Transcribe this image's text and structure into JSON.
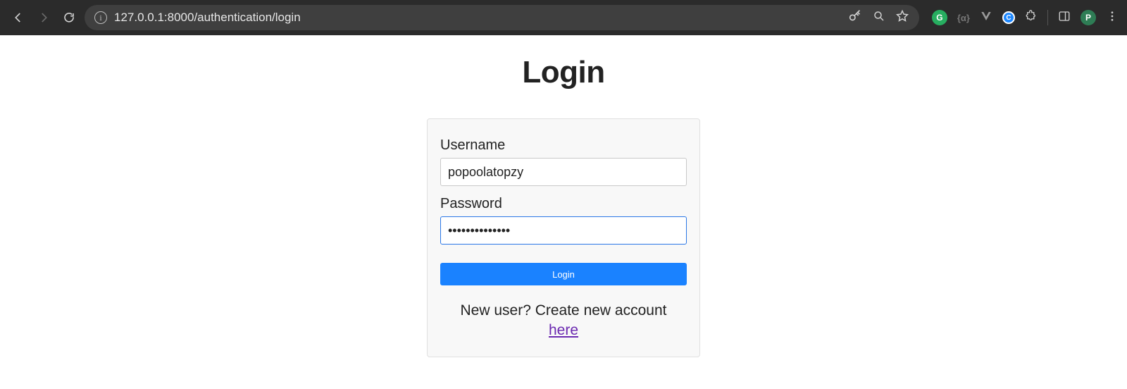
{
  "browser": {
    "url": "127.0.0.1:8000/authentication/login",
    "profile_initial": "P"
  },
  "page": {
    "title": "Login"
  },
  "form": {
    "username_label": "Username",
    "username_value": "popoolatopzy",
    "password_label": "Password",
    "password_value": "••••••••••••••",
    "submit_label": "Login"
  },
  "signup": {
    "prompt": "New user? Create new account",
    "link_text": "here"
  }
}
